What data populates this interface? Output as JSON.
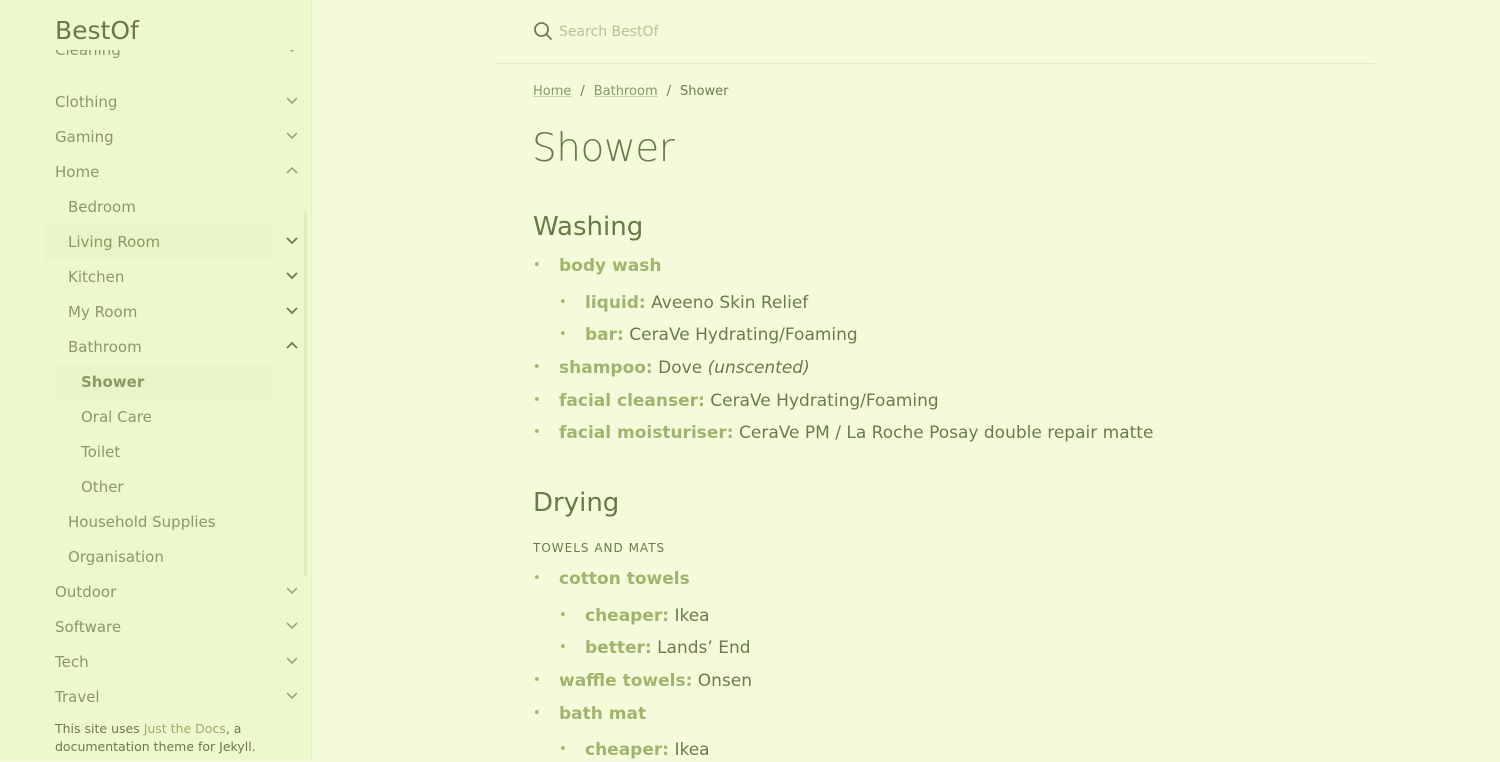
{
  "site": {
    "title": "BestOf"
  },
  "search": {
    "placeholder": "Search BestOf"
  },
  "sidebar": {
    "items": [
      {
        "label": "Cleaning",
        "expanded": false
      },
      {
        "label": "Clothing",
        "expanded": false
      },
      {
        "label": "Gaming",
        "expanded": false
      },
      {
        "label": "Home",
        "expanded": true
      },
      {
        "label": "Bedroom"
      },
      {
        "label": "Living Room",
        "expanded": false
      },
      {
        "label": "Kitchen",
        "expanded": false
      },
      {
        "label": "My Room",
        "expanded": false
      },
      {
        "label": "Bathroom",
        "expanded": true
      },
      {
        "label": "Shower",
        "active": true
      },
      {
        "label": "Oral Care"
      },
      {
        "label": "Toilet"
      },
      {
        "label": "Other"
      },
      {
        "label": "Household Supplies"
      },
      {
        "label": "Organisation"
      },
      {
        "label": "Outdoor",
        "expanded": false
      },
      {
        "label": "Software",
        "expanded": false
      },
      {
        "label": "Tech",
        "expanded": false
      },
      {
        "label": "Travel",
        "expanded": false
      }
    ]
  },
  "footer": {
    "prefix": "This site uses ",
    "link": "Just the Docs",
    "suffix": ", a documentation theme for Jekyll."
  },
  "breadcrumb": [
    "Home",
    "Bathroom",
    "Shower"
  ],
  "page": {
    "title": "Shower",
    "sections": [
      {
        "title": "Washing",
        "items": [
          {
            "label": "body wash",
            "value": ""
          },
          {
            "label": "liquid:",
            "value": "Aveeno Skin Relief"
          },
          {
            "label": "bar:",
            "value": "CeraVe Hydrating/Foaming"
          },
          {
            "label": "shampoo:",
            "value": "Dove",
            "note": "(unscented)"
          },
          {
            "label": "facial cleanser:",
            "value": "CeraVe Hydrating/Foaming"
          },
          {
            "label": "facial moisturiser:",
            "value": "CeraVe PM / La Roche Posay double repair matte"
          }
        ]
      },
      {
        "title": "Drying",
        "subheading": "TOWELS AND MATS",
        "items": [
          {
            "label": "cotton towels",
            "value": ""
          },
          {
            "label": "cheaper:",
            "value": "Ikea"
          },
          {
            "label": "better:",
            "value": "Lands’ End"
          },
          {
            "label": "waffle towels:",
            "value": "Onsen"
          },
          {
            "label": "bath mat",
            "value": ""
          },
          {
            "label": "cheaper:",
            "value": "Ikea"
          }
        ]
      }
    ]
  },
  "colors": {
    "background": "#f4fbdb",
    "sidebar": "#eef8cf",
    "accent": "#a3b36d",
    "text": "#6e7a4c"
  }
}
